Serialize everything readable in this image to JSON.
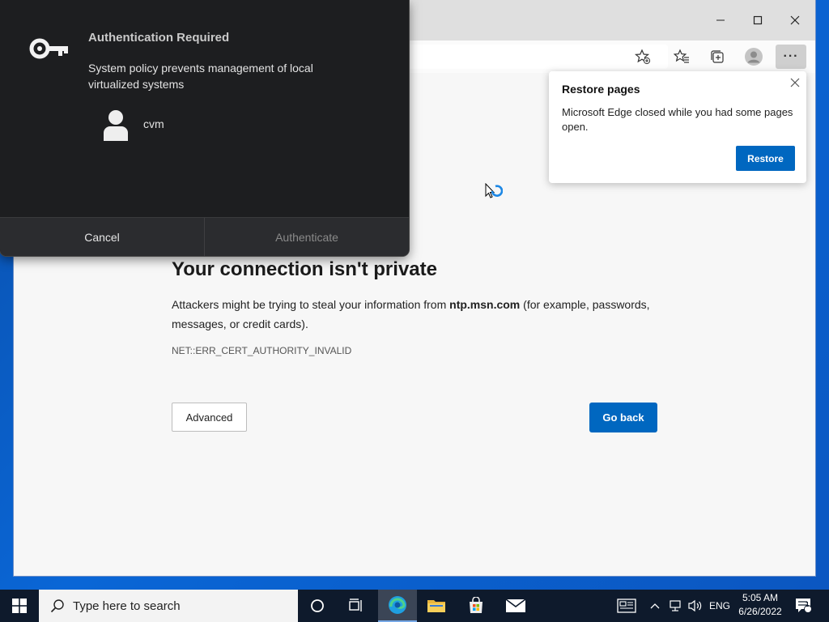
{
  "browser": {
    "window_controls": {
      "minimize": "—",
      "maximize": "☐",
      "close": "✕"
    },
    "toolbar_icons": [
      "favorite-add-icon",
      "favorites-icon",
      "collections-icon",
      "profile-icon",
      "more-icon"
    ],
    "more_label": "···"
  },
  "error_page": {
    "title": "Your connection isn't private",
    "description_prefix": "Attackers might be trying to steal your information from ",
    "domain": "ntp.msn.com",
    "description_suffix": " (for example, passwords, messages, or credit cards).",
    "error_code": "NET::ERR_CERT_AUTHORITY_INVALID",
    "advanced_label": "Advanced",
    "go_back_label": "Go back"
  },
  "restore_popup": {
    "title": "Restore pages",
    "body": "Microsoft Edge closed while you had some pages open.",
    "restore_label": "Restore"
  },
  "auth_dialog": {
    "title": "Authentication Required",
    "message": "System policy prevents management of local virtualized systems",
    "user": "cvm",
    "cancel_label": "Cancel",
    "authenticate_label": "Authenticate"
  },
  "taskbar": {
    "search_placeholder": "Type here to search",
    "language": "ENG",
    "time": "5:05 AM",
    "date": "6/26/2022",
    "notification_count": "1"
  },
  "colors": {
    "accent": "#0067c0",
    "desktop": "#0a66d6",
    "dialog_bg": "#1d1e20",
    "taskbar_bg": "#0e1a2c"
  }
}
